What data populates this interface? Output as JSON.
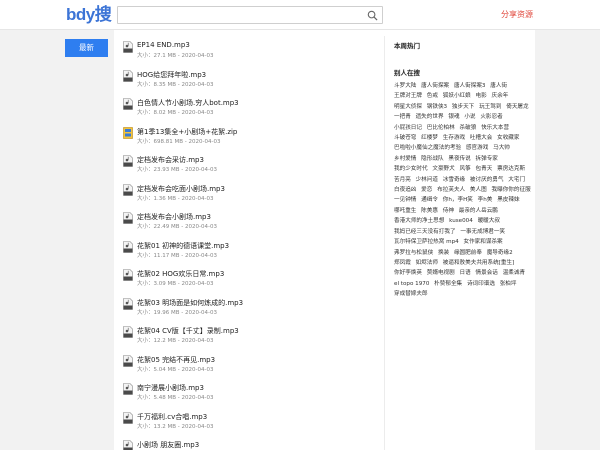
{
  "header": {
    "logo_latin": "bdy",
    "logo_cn": "搜",
    "search_placeholder": "",
    "share_label": "分享资源"
  },
  "nav": {
    "latest_label": "最新"
  },
  "files": [
    {
      "name": "EP14 END.mp3",
      "meta": "大小：27.1 MB - 2020-04-03",
      "icon": "audio-file-icon"
    },
    {
      "name": "HOG给您拜年啦.mp3",
      "meta": "大小：8.35 MB - 2020-04-03",
      "icon": "audio-file-icon"
    },
    {
      "name": "白色情人节小剧场.穷人bot.mp3",
      "meta": "大小：8.02 MB - 2020-04-03",
      "icon": "audio-file-icon"
    },
    {
      "name": "第1季13集全+小剧场+花絮.zip",
      "meta": "大小：698.81 MB - 2020-04-03",
      "icon": "zip-file-icon"
    },
    {
      "name": "定档发布会采访.mp3",
      "meta": "大小：23.93 MB - 2020-04-03",
      "icon": "audio-file-icon"
    },
    {
      "name": "定档发布会吃面小剧场.mp3",
      "meta": "大小：1.36 MB - 2020-04-03",
      "icon": "audio-file-icon"
    },
    {
      "name": "定档发布会小剧场.mp3",
      "meta": "大小：22.49 MB - 2020-04-03",
      "icon": "audio-file-icon"
    },
    {
      "name": "花絮01 初神的德语课堂.mp3",
      "meta": "大小：11.17 MB - 2020-04-03",
      "icon": "audio-file-icon"
    },
    {
      "name": "花絮02 HOG欢乐日常.mp3",
      "meta": "大小：3.09 MB - 2020-04-03",
      "icon": "audio-file-icon"
    },
    {
      "name": "花絮03 明场面是如何炼成的.mp3",
      "meta": "大小：19.96 MB - 2020-04-03",
      "icon": "audio-file-icon"
    },
    {
      "name": "花絮04 CV版【千丈】录制.mp3",
      "meta": "大小：12.2 MB - 2020-04-03",
      "icon": "audio-file-icon"
    },
    {
      "name": "花絮05 完结不再见.mp3",
      "meta": "大小：5.04 MB - 2020-04-03",
      "icon": "audio-file-icon"
    },
    {
      "name": "南宁漫展小剧场.mp3",
      "meta": "大小：5.48 MB - 2020-04-03",
      "icon": "audio-file-icon"
    },
    {
      "name": "千万福利.cv合唱.mp3",
      "meta": "大小：13.2 MB - 2020-04-03",
      "icon": "audio-file-icon"
    },
    {
      "name": "小剧场 朋友圈.mp3",
      "meta": "",
      "icon": "audio-file-icon"
    }
  ],
  "sidebar": {
    "hot_title": "本周热门",
    "recent_title": "别人在搜",
    "tags": [
      "斗罗大陆",
      "唐人街探案",
      "唐人街探案3",
      "唐人街",
      "王牌对王牌",
      "色戒",
      "狐妖小红娘",
      "电影",
      "庆余年",
      "明星大侦探",
      "钢铁侠3",
      "独步天下",
      "玩王驾到",
      "倚天屠龙",
      "一把青",
      "遗失的世界",
      "银魂",
      "小说",
      "火影忍者",
      "小屁孩日记",
      "巴比伦柏林",
      "杀破狼",
      "快乐大本营",
      "斗破苍穹",
      "红楼梦",
      "生存游戏",
      "吐槽大会",
      "女收藏家",
      "巴啦啦小魔仙之魔法的考验",
      "感官游戏",
      "马大帅",
      "乡村爱情",
      "隐形战队",
      "黑夜传说",
      "拆弹专家",
      "我的少女时代",
      "文豪野犬",
      "风筝",
      "包青天",
      "票房达克斯",
      "苦月亮",
      "少林问道",
      "冰雪奇缘",
      "被讨厌的勇气",
      "大宅门",
      "白夜追凶",
      "爱恋",
      "布拉芙夫人",
      "美人图",
      "我曝你你的征服",
      "一见钟情",
      "通缉令",
      "你h，李H笑",
      "李h美",
      "黑皮辣妹",
      "哪吒重生",
      "陈美惠",
      "侍神",
      "最亲的人岳云鹏",
      "香港大师的净土思想",
      "kuse004",
      "暖暖大叔",
      "我妈已经三天没有打我了",
      "一事无成博君一笑",
      "瓦尔特保卫萨拉热窝 mp4",
      "女作家和谋杀案",
      "弗罗拉与松鼠侠",
      "换装",
      "缘圆肥前奉",
      "魔导奇缘2",
      "郑凤霞",
      "如烬法师",
      "被逼和敖美夫共用系统[重生]",
      "你好李焕英",
      "赘婿电视剧",
      "日语",
      "情景会话",
      "温柔诚青",
      "el topo 1970",
      "朴赞郁全集",
      "诗词印谱选",
      "张柏坪",
      "穿成替嫁夫郎"
    ]
  },
  "colors": {
    "accent": "#2e7ef0",
    "share": "#e0483c",
    "logo_blue": "#3c74d6",
    "logo_orange": "#e9a321"
  }
}
